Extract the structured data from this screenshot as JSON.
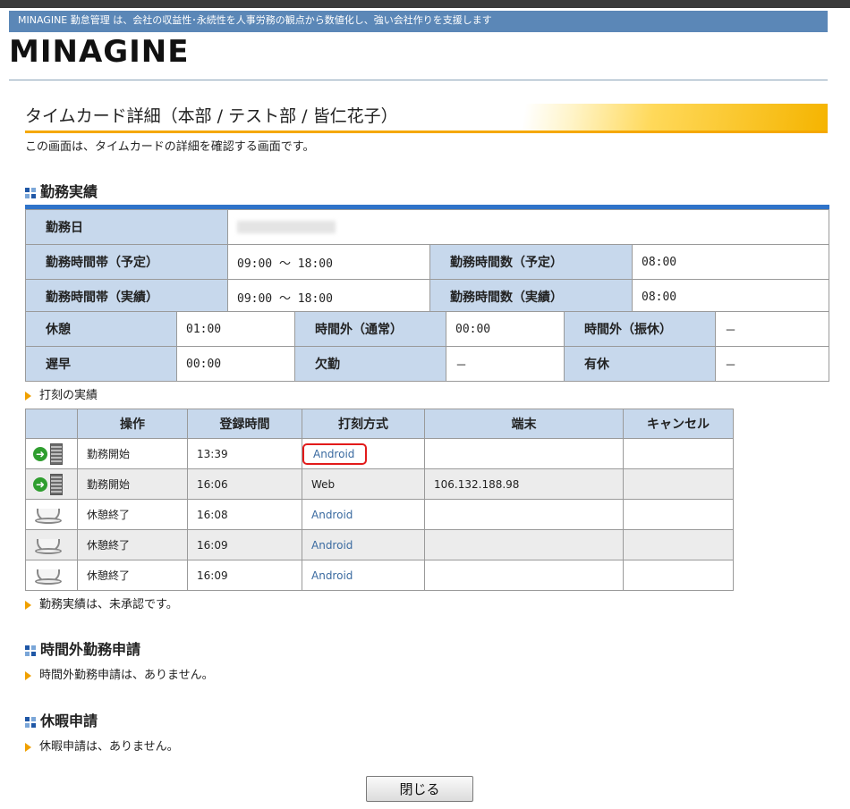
{
  "header": {
    "tagline": "MINAGINE 勤怠管理 は、会社の収益性･永続性を人事労務の観点から数値化し、強い会社作りを支援します",
    "logo": "MINAGINE"
  },
  "page": {
    "title": "タイムカード詳細（本部 / テスト部 / 皆仁花子）",
    "description": "この画面は、タイムカードの詳細を確認する画面です。"
  },
  "work_record": {
    "heading": "勤務実績",
    "date_label": "勤務日",
    "date_value": "",
    "sched_band_label": "勤務時間帯（予定）",
    "sched_band_value": "09:00 ～ 18:00",
    "sched_hours_label": "勤務時間数（予定）",
    "sched_hours_value": "08:00",
    "actual_band_label": "勤務時間帯（実績）",
    "actual_band_value": "09:00 ～ 18:00",
    "actual_hours_label": "勤務時間数（実績）",
    "actual_hours_value": "08:00",
    "break_label": "休憩",
    "break_value": "01:00",
    "overtime_normal_label": "時間外（通常）",
    "overtime_normal_value": "00:00",
    "overtime_sub_label": "時間外（振休）",
    "overtime_sub_value": "－",
    "late_label": "遅早",
    "late_value": "00:00",
    "absence_label": "欠勤",
    "absence_value": "－",
    "paid_leave_label": "有休",
    "paid_leave_value": "－"
  },
  "punch": {
    "subheading": "打刻の実績",
    "columns": [
      "",
      "操作",
      "登録時間",
      "打刻方式",
      "端末",
      "キャンセル"
    ],
    "rows": [
      {
        "icon": "go-building-icon",
        "op": "勤務開始",
        "time": "13:39",
        "method": "Android",
        "terminal": "",
        "cancel": ""
      },
      {
        "icon": "go-building-icon",
        "op": "勤務開始",
        "time": "16:06",
        "method": "Web",
        "terminal": "106.132.188.98",
        "cancel": ""
      },
      {
        "icon": "coffee-cup-icon",
        "op": "休憩終了",
        "time": "16:08",
        "method": "Android",
        "terminal": "",
        "cancel": ""
      },
      {
        "icon": "coffee-cup-icon",
        "op": "休憩終了",
        "time": "16:09",
        "method": "Android",
        "terminal": "",
        "cancel": ""
      },
      {
        "icon": "coffee-cup-icon",
        "op": "休憩終了",
        "time": "16:09",
        "method": "Android",
        "terminal": "",
        "cancel": ""
      }
    ],
    "status": "勤務実績は、未承認です。"
  },
  "overtime_request": {
    "heading": "時間外勤務申請",
    "message": "時間外勤務申請は、ありません。"
  },
  "leave_request": {
    "heading": "休暇申請",
    "message": "休暇申請は、ありません。"
  },
  "close_button": "閉じる",
  "colors": {
    "tagline_bar": "#5b87b7",
    "label_cell": "#c7d8ec",
    "accent_orange": "#f5a800",
    "highlight_red": "#e21b1b"
  }
}
